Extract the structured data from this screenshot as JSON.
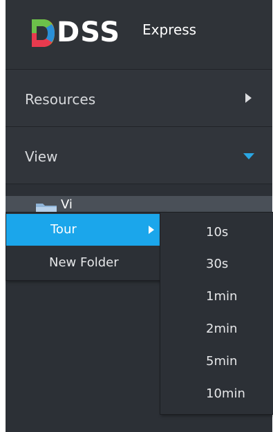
{
  "brand": {
    "name": "DSS",
    "sub": "Express"
  },
  "nav": {
    "resources_label": "Resources",
    "view_label": "View"
  },
  "tree": {
    "folder_label": "Vi"
  },
  "context_menu": {
    "tour_label": "Tour",
    "new_folder_label": "New Folder"
  },
  "tour_submenu": [
    "10s",
    "30s",
    "1min",
    "2min",
    "5min",
    "10min"
  ],
  "colors": {
    "accent": "#1ba6eb",
    "panel": "#2c3036",
    "header": "#2f3338",
    "selected_row": "#4a5058"
  }
}
